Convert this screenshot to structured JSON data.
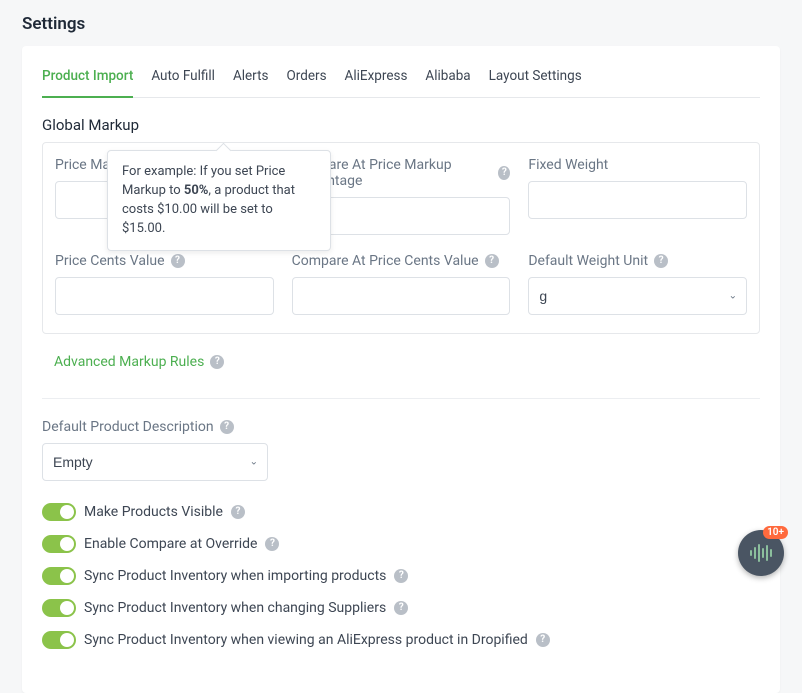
{
  "pageTitle": "Settings",
  "tabs": [
    {
      "label": "Product Import",
      "active": true
    },
    {
      "label": "Auto Fulfill",
      "active": false
    },
    {
      "label": "Alerts",
      "active": false
    },
    {
      "label": "Orders",
      "active": false
    },
    {
      "label": "AliExpress",
      "active": false
    },
    {
      "label": "Alibaba",
      "active": false
    },
    {
      "label": "Layout Settings",
      "active": false
    }
  ],
  "globalMarkup": {
    "heading": "Global Markup",
    "fields": {
      "priceMarkupPercentage": {
        "label": "Price Markup Percentage",
        "value": ""
      },
      "compareAtPriceMarkupPercentage": {
        "label": "Compare At Price Markup Percentage",
        "value": ""
      },
      "fixedWeight": {
        "label": "Fixed Weight",
        "value": ""
      },
      "priceCentsValue": {
        "label": "Price Cents Value",
        "value": ""
      },
      "compareAtPriceCentsValue": {
        "label": "Compare At Price Cents Value",
        "value": ""
      },
      "defaultWeightUnit": {
        "label": "Default Weight Unit",
        "value": "g"
      }
    }
  },
  "tooltip": {
    "prefix": "For example: If you set Price Markup to ",
    "bold": "50%",
    "suffix": ", a product that costs $10.00 will be set to $15.00."
  },
  "advancedRules": {
    "label": "Advanced Markup Rules"
  },
  "defaultProductDescription": {
    "label": "Default Product Description",
    "value": "Empty"
  },
  "toggles": [
    {
      "label": "Make Products Visible",
      "on": true
    },
    {
      "label": "Enable Compare at Override",
      "on": true
    },
    {
      "label": "Sync Product Inventory when importing products",
      "on": true
    },
    {
      "label": "Sync Product Inventory when changing Suppliers",
      "on": true
    },
    {
      "label": "Sync Product Inventory when viewing an AliExpress product in Dropified",
      "on": true
    }
  ],
  "fab": {
    "badge": "10+"
  }
}
